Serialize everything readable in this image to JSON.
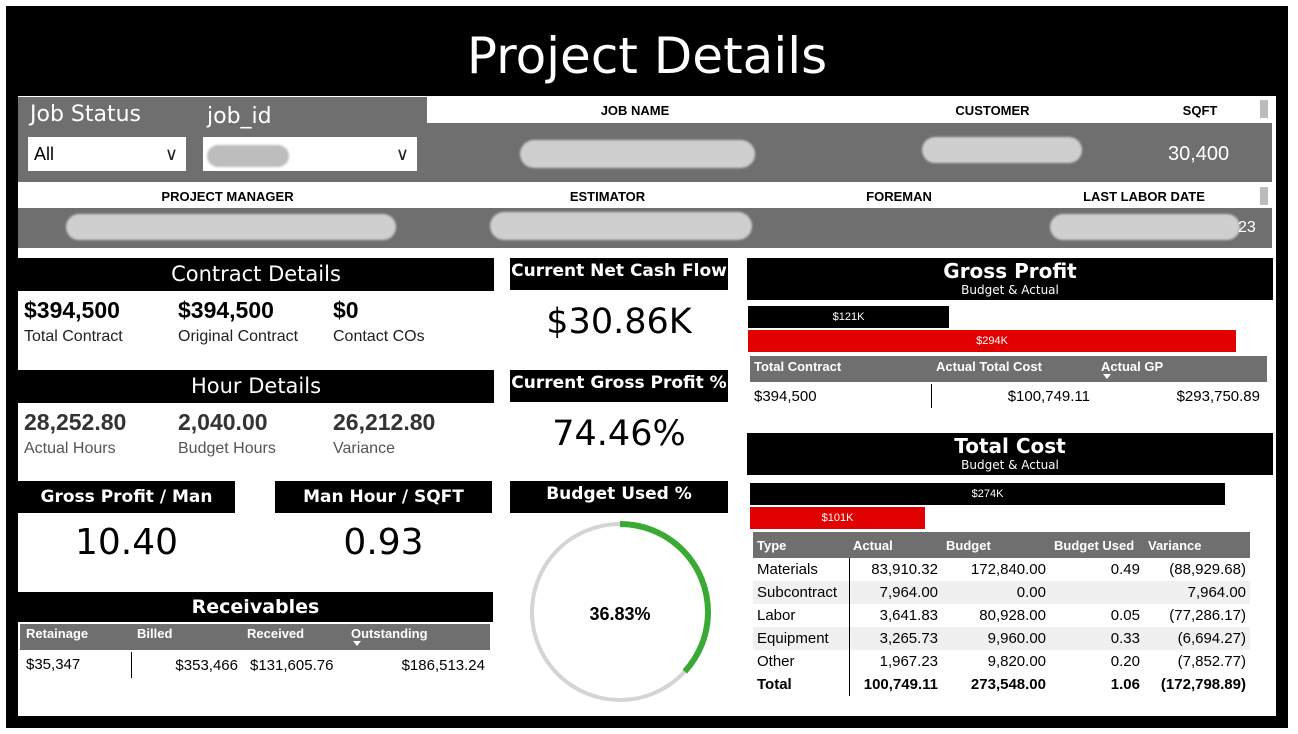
{
  "page": {
    "title": "Project Details"
  },
  "filters": {
    "job_status": {
      "label": "Job Status",
      "value": "All"
    },
    "job_id": {
      "label": "job_id",
      "value": ""
    }
  },
  "info_row1": {
    "headers": [
      "JOB NAME",
      "CUSTOMER",
      "SQFT"
    ],
    "sqft_value": "30,400"
  },
  "info_row2": {
    "headers": [
      "PROJECT MANAGER",
      "ESTIMATOR",
      "FOREMAN",
      "LAST LABOR DATE"
    ],
    "last_labor_suffix": "23"
  },
  "contract": {
    "title": "Contract Details",
    "items": [
      {
        "value": "$394,500",
        "label": "Total Contract"
      },
      {
        "value": "$394,500",
        "label": "Original Contract"
      },
      {
        "value": "$0",
        "label": "Contact COs"
      }
    ]
  },
  "hours": {
    "title": "Hour Details",
    "items": [
      {
        "value": "28,252.80",
        "label": "Actual Hours"
      },
      {
        "value": "2,040.00",
        "label": "Budget Hours"
      },
      {
        "value": "26,212.80",
        "label": "Variance"
      }
    ]
  },
  "gp_per_man_hour": {
    "title": "Gross Profit / Man Hour",
    "value": "10.40"
  },
  "man_hour_sqft": {
    "title": "Man Hour / SQFT",
    "value": "0.93"
  },
  "net_cash_flow": {
    "title": "Current Net Cash Flow",
    "value": "$30.86K"
  },
  "gross_profit_pct": {
    "title": "Current Gross Profit %",
    "value": "74.46%"
  },
  "budget_used": {
    "title": "Budget Used %",
    "label": "36.83%",
    "fraction": 0.3683
  },
  "receivables": {
    "title": "Receivables",
    "columns": [
      "Retainage",
      "Billed",
      "Received",
      "Outstanding"
    ],
    "row": [
      "$35,347",
      "$353,466",
      "$131,605.76",
      "$186,513.24"
    ]
  },
  "gross_profit": {
    "title": "Gross Profit",
    "subtitle": "Budget & Actual",
    "columns": [
      "Total Contract",
      "Actual Total Cost",
      "Actual GP"
    ],
    "row": [
      "$394,500",
      "$100,749.11",
      "$293,750.89"
    ]
  },
  "total_cost": {
    "title": "Total Cost",
    "subtitle": "Budget & Actual",
    "columns": [
      "Type",
      "Actual",
      "Budget",
      "Budget Used",
      "Variance"
    ],
    "rows": [
      [
        "Materials",
        "83,910.32",
        "172,840.00",
        "0.49",
        "(88,929.68)"
      ],
      [
        "Subcontract",
        "7,964.00",
        "0.00",
        "",
        "7,964.00"
      ],
      [
        "Labor",
        "3,641.83",
        "80,928.00",
        "0.05",
        "(77,286.17)"
      ],
      [
        "Equipment",
        "3,265.73",
        "9,960.00",
        "0.33",
        "(6,694.27)"
      ],
      [
        "Other",
        "1,967.23",
        "9,820.00",
        "0.20",
        "(7,852.77)"
      ]
    ],
    "total": [
      "Total",
      "100,749.11",
      "273,548.00",
      "1.06",
      "(172,798.89)"
    ]
  },
  "chart_data": [
    {
      "type": "bar",
      "orientation": "horizontal",
      "categories": [
        "Budget",
        "Actual"
      ],
      "values": [
        121000,
        294000
      ],
      "labels": [
        "$121K",
        "$294K"
      ],
      "colors": [
        "#000000",
        "#e00000"
      ]
    },
    {
      "type": "bar",
      "orientation": "horizontal",
      "categories": [
        "Budget",
        "Actual"
      ],
      "values": [
        274000,
        101000
      ],
      "labels": [
        "$274K",
        "$101K"
      ],
      "colors": [
        "#000000",
        "#e00000"
      ]
    }
  ],
  "colors": {
    "accent_red": "#e00000",
    "gauge_green": "#3aaa35",
    "band_grey": "#6f6f6f"
  }
}
